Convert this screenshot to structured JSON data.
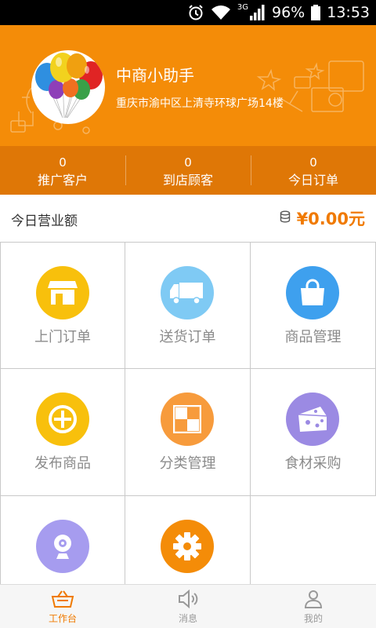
{
  "status_bar": {
    "network": "3G",
    "battery": "96%",
    "time": "13:53"
  },
  "header": {
    "shop_name": "中商小助手",
    "address": "重庆市渝中区上清寺环球广场14楼"
  },
  "stats": [
    {
      "value": "0",
      "label": "推广客户"
    },
    {
      "value": "0",
      "label": "到店顾客"
    },
    {
      "value": "0",
      "label": "今日订单"
    }
  ],
  "revenue": {
    "title": "今日营业额",
    "amount": "¥0.00元"
  },
  "grid": [
    {
      "label": "上门订单",
      "icon": "store-icon",
      "color": "#f8c00c"
    },
    {
      "label": "送货订单",
      "icon": "truck-icon",
      "color": "#7fcaf4"
    },
    {
      "label": "商品管理",
      "icon": "shopping-bag-icon",
      "color": "#3ea0ee"
    },
    {
      "label": "发布商品",
      "icon": "plus-circle-icon",
      "color": "#f8c00c"
    },
    {
      "label": "分类管理",
      "icon": "category-grid-icon",
      "color": "#f79b3c"
    },
    {
      "label": "食材采购",
      "icon": "cheese-icon",
      "color": "#9b8ae3"
    },
    {
      "label": "",
      "icon": "webcam-icon",
      "color": "#a69cef"
    },
    {
      "label": "",
      "icon": "gear-icon",
      "color": "#f48c08"
    }
  ],
  "bottom_nav": [
    {
      "label": "工作台",
      "icon": "basket-icon",
      "active": true
    },
    {
      "label": "消息",
      "icon": "speaker-icon",
      "active": false
    },
    {
      "label": "我的",
      "icon": "user-icon",
      "active": false
    }
  ],
  "colors": {
    "accent": "#f48c08",
    "stats_bar": "#df7706",
    "amount": "#f07a00"
  }
}
